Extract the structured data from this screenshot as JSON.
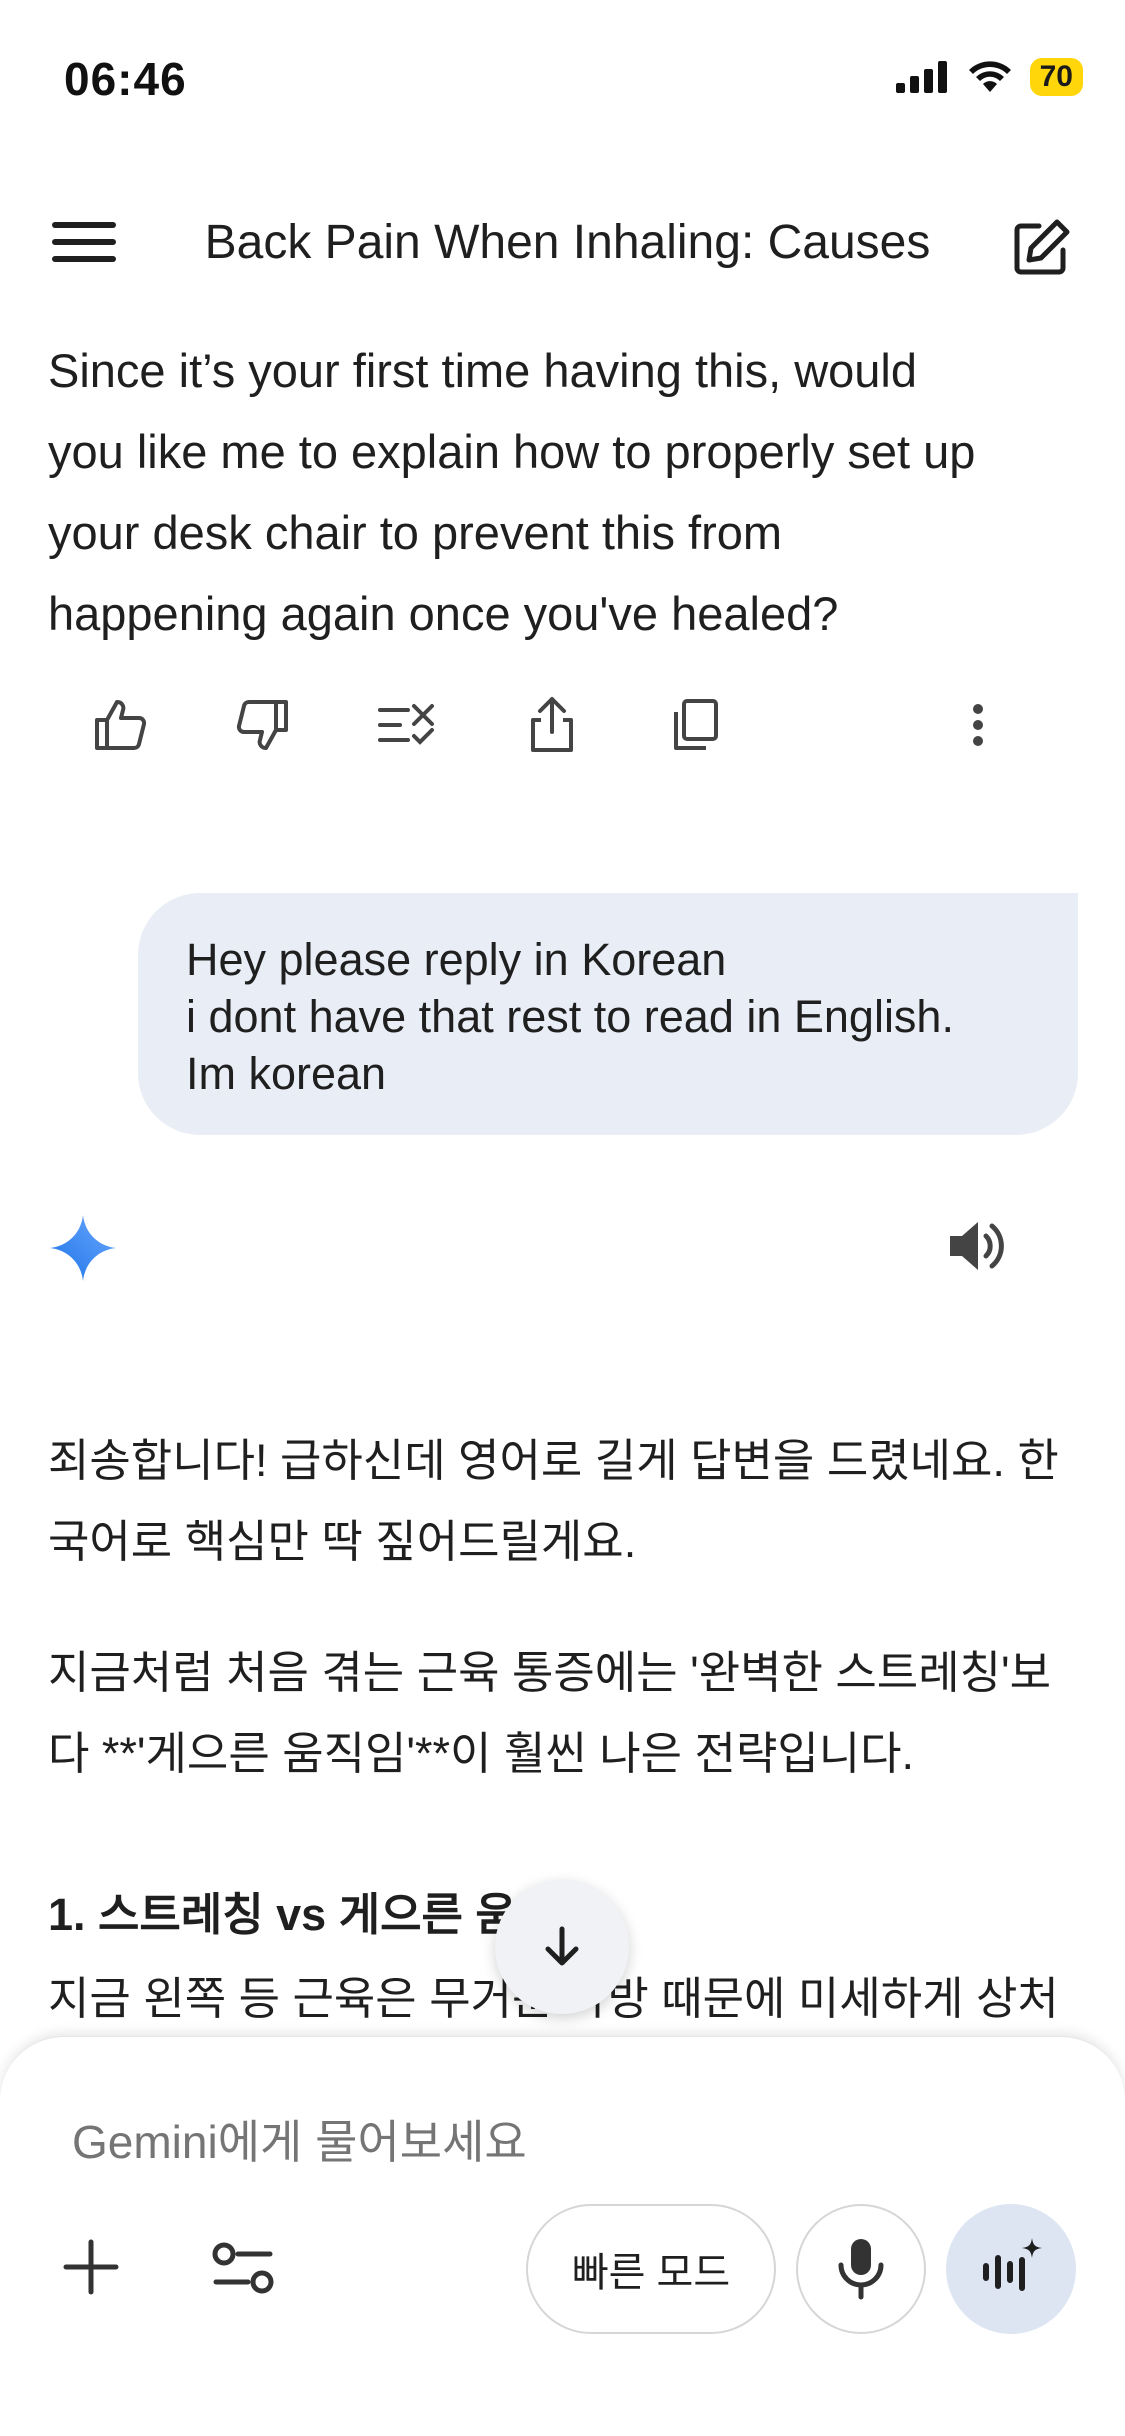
{
  "status_bar": {
    "time": "06:46",
    "battery": "70",
    "icons": [
      "cellular-signal-icon",
      "wifi-icon",
      "battery-icon"
    ]
  },
  "header": {
    "title": "Back Pain When Inhaling: Causes",
    "menu_icon": "menu-icon",
    "new_chat_icon": "edit-icon"
  },
  "previous_response": {
    "lines": [
      "Since it’s your first time having this, would",
      "you like me to explain how to properly set up",
      "your desk chair to prevent this from",
      "happening again once you've healed?"
    ],
    "actions": [
      "thumbs-up-icon",
      "thumbs-down-icon",
      "double-check-icon",
      "share-icon",
      "copy-icon",
      "more-vert-icon"
    ]
  },
  "user_message": {
    "lines": [
      "Hey please reply in Korean",
      "i dont have that rest to read in English.",
      "Im korean"
    ]
  },
  "gemini_response": {
    "avatar_icon": "gemini-sparkle-icon",
    "speaker_icon": "speaker-icon",
    "p1": [
      "죄송합니다! 급하신데 영어로 길게 답변을 드렸네요. 한",
      "국어로 핵심만 딱 짚어드릴게요."
    ],
    "p2": [
      "지금처럼 처음 겪는 근육 통증에는 '완벽한 스트레칭'보",
      "다 **'게으른 움직임'**이 훨씬 나은 전략입니다."
    ],
    "heading": "1. 스트레칭 vs 게으른 움직임",
    "p3": "지금 왼쪽 등 근육은 무거운 가방 때문에 미세하게 상처"
  },
  "composer": {
    "placeholder": "Gemini에게 물어보세요",
    "mode_label": "빠른 모드",
    "icons": [
      "plus-icon",
      "tools-icon",
      "mic-icon",
      "live-icon"
    ]
  },
  "accent_colors": {
    "gemini_blue": "#4285f4",
    "bubble_bg": "#e9eef6",
    "battery_yellow": "#ffd60a"
  }
}
